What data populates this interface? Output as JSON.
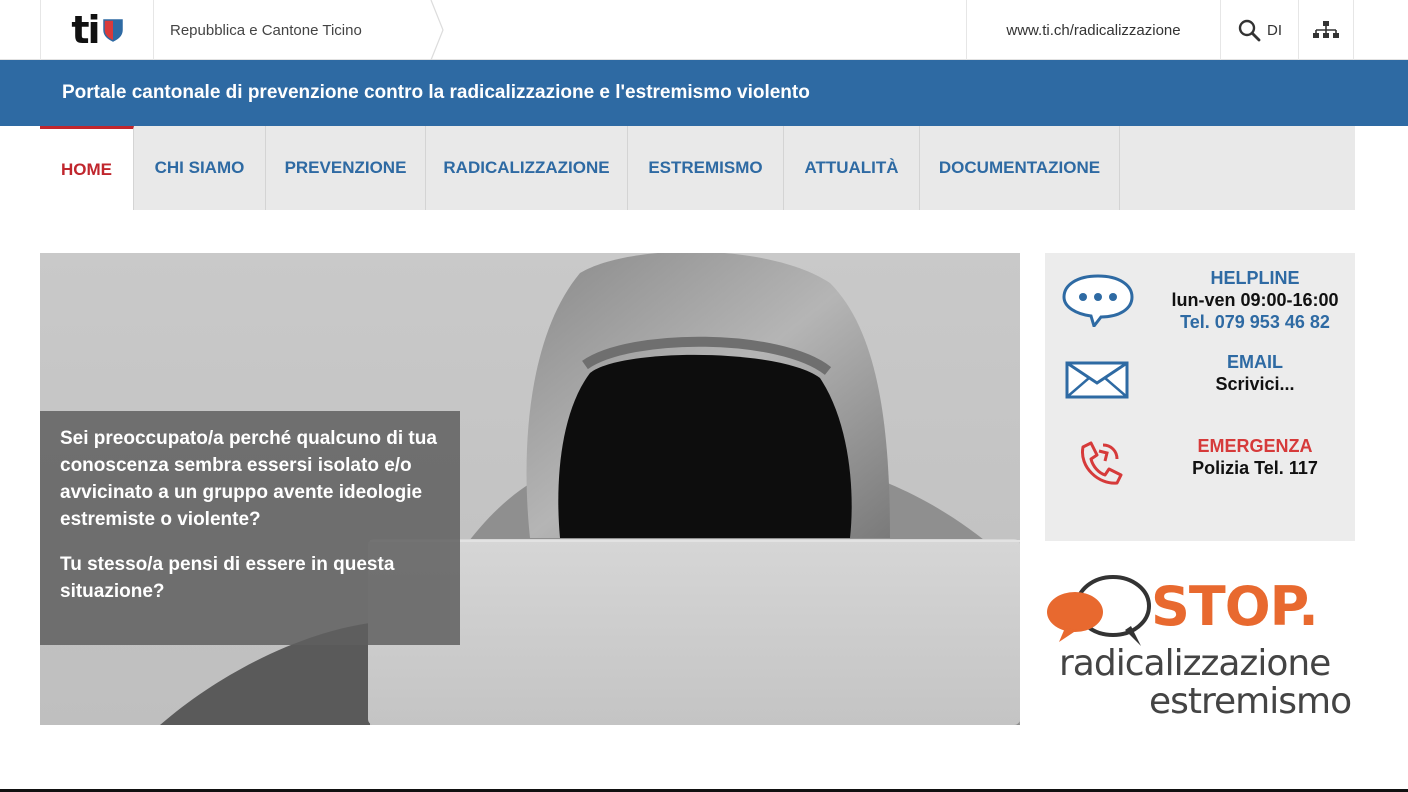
{
  "header": {
    "logo_text": "ti",
    "org_name": "Repubblica e Cantone Ticino",
    "url": "www.ti.ch/radicalizzazione",
    "language": "DI",
    "colors": {
      "brand_blue": "#2e6aa3",
      "active_red": "#c0262d"
    }
  },
  "banner": {
    "title": "Portale cantonale di prevenzione contro la radicalizzazione e l'estremismo violento"
  },
  "nav": {
    "items": [
      {
        "label": "HOME",
        "active": true
      },
      {
        "label": "CHI SIAMO",
        "active": false
      },
      {
        "label": "PREVENZIONE",
        "active": false
      },
      {
        "label": "RADICALIZZAZIONE",
        "active": false
      },
      {
        "label": "ESTREMISMO",
        "active": false
      },
      {
        "label": "ATTUALITÀ",
        "active": false
      },
      {
        "label": "DOCUMENTAZIONE",
        "active": false
      }
    ]
  },
  "hero": {
    "paragraph1": "Sei preoccupato/a perché qualcuno di tua conoscenza sembra essersi isolato e/o avvicinato a un gruppo avente ideologie estremiste o violente?",
    "paragraph2": "Tu stesso/a pensi di essere in questa situazione?"
  },
  "contacts": {
    "helpline": {
      "icon": "chat-bubble-icon",
      "title": "HELPLINE",
      "hours": "lun-ven 09:00-16:00",
      "phone": "Tel. 079 953 46 82"
    },
    "email": {
      "icon": "envelope-icon",
      "title": "EMAIL",
      "action": "Scrivici..."
    },
    "emergency": {
      "icon": "phone-icon",
      "title": "EMERGENZA",
      "phone": "Polizia Tel. 117"
    }
  },
  "stop_logo": {
    "word": "STOP.",
    "line1": "radicalizzazione",
    "line2": "estremismo",
    "colors": {
      "orange": "#e8692f",
      "gray": "#444444"
    }
  }
}
